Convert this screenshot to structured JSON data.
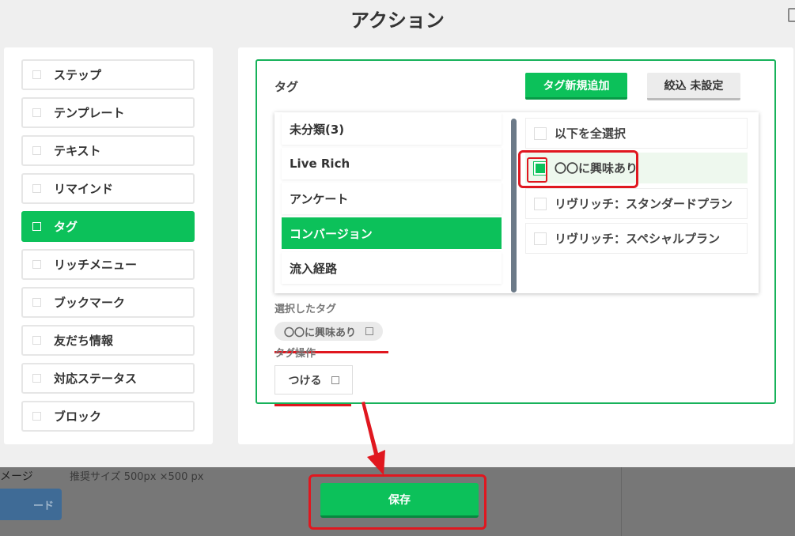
{
  "modal": {
    "title": "アクション"
  },
  "menu": [
    {
      "label": "ステップ",
      "active": false
    },
    {
      "label": "テンプレート",
      "active": false
    },
    {
      "label": "テキスト",
      "active": false
    },
    {
      "label": "リマインド",
      "active": false
    },
    {
      "label": "タグ",
      "active": true
    },
    {
      "label": "リッチメニュー",
      "active": false
    },
    {
      "label": "ブックマーク",
      "active": false
    },
    {
      "label": "友だち情報",
      "active": false
    },
    {
      "label": "対応ステータス",
      "active": false
    },
    {
      "label": "ブロック",
      "active": false
    }
  ],
  "tag_panel": {
    "heading": "タグ",
    "new_tag_button": "タグ新規追加",
    "filter_button": "絞込 未設定",
    "categories": [
      {
        "label": "未分類(3)",
        "active": false
      },
      {
        "label": "Live Rich",
        "active": false
      },
      {
        "label": "アンケート",
        "active": false
      },
      {
        "label": "コンバージョン",
        "active": true
      },
      {
        "label": "流入経路",
        "active": false
      }
    ],
    "tags": [
      {
        "label": "以下を全選択",
        "checked": false
      },
      {
        "label": "〇〇に興味あり",
        "checked": true
      },
      {
        "label": "リヴリッチ：スタンダードプラン",
        "checked": false
      },
      {
        "label": "リヴリッチ：スペシャルプラン",
        "checked": false
      }
    ],
    "selected_label": "選択したタグ",
    "selected_chip": "〇〇に興味あり",
    "operation_label": "タグ操作",
    "operation_value": "つける"
  },
  "save_button": "保存",
  "background": {
    "label": "メージ",
    "hint": "推奨サイズ 500px ×500 px",
    "upload_button": "ード"
  },
  "colors": {
    "accent": "#0cc15a",
    "annotation": "#e0171f"
  }
}
